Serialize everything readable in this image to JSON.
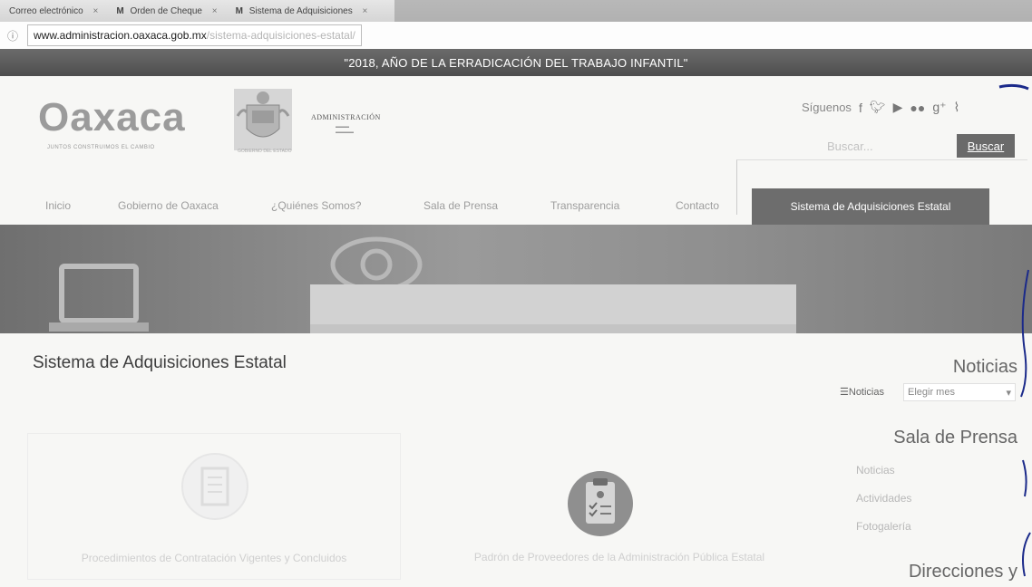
{
  "browser": {
    "tabs": [
      {
        "label": "Correo electrónico",
        "icon": "mail-icon"
      },
      {
        "label": "Orden de Cheque"
      },
      {
        "label": "Sistema de Adquisiciones"
      }
    ],
    "url_host": "www.administracion.oaxaca.gob.mx",
    "url_path": "/sistema-adquisiciones-estatal/"
  },
  "banner": {
    "text": "\"2018, AÑO DE LA ERRADICACIÓN DEL TRABAJO INFANTIL\""
  },
  "header": {
    "logo_text": "Oaxaca",
    "logo_sub": "JUNTOS CONSTRUIMOS EL CAMBIO",
    "crest_caption": "GOBIERNO DEL ESTADO",
    "admin_label": "ADMINISTRACIÓN",
    "social_label": "Síguenos",
    "social_icons": [
      "facebook-icon",
      "twitter-icon",
      "youtube-icon",
      "flickr-icon",
      "google-plus-icon",
      "rss-icon"
    ],
    "search_placeholder": "Buscar...",
    "search_button": "Buscar"
  },
  "nav": {
    "items": [
      "Inicio",
      "Gobierno de Oaxaca",
      "¿Quiénes Somos?",
      "Sala de Prensa",
      "Transparencia",
      "Contacto"
    ],
    "active": "Sistema de Adquisiciones Estatal"
  },
  "main": {
    "title": "Sistema de Adquisiciones Estatal",
    "cards": [
      {
        "label": "Procedimientos de Contratación Vigentes y Concluidos",
        "icon": "contract-document-icon"
      },
      {
        "label": "Padrón de Proveedores de la Administración Pública Estatal",
        "icon": "clipboard-checklist-icon"
      }
    ]
  },
  "sidebar": {
    "news_heading": "Noticias",
    "archive_label": "Noticias",
    "archive_select": "Elegir mes",
    "press_heading": "Sala de Prensa",
    "press_links": [
      "Noticias",
      "Actividades",
      "Fotogalería"
    ],
    "directions_heading": "Direcciones y"
  },
  "colors": {
    "banner": "#5c5c5c",
    "nav_active": "#6d6d6d",
    "search_button": "#6a6a6a",
    "annotation_ink": "#1b2a8a"
  }
}
